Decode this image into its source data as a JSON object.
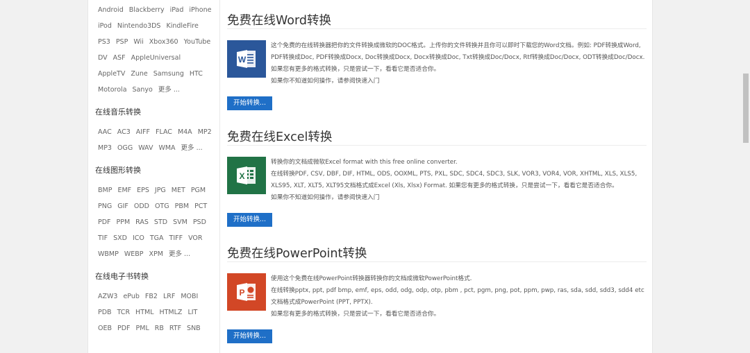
{
  "sidebar": {
    "devices": [
      "Android",
      "Blackberry",
      "iPad",
      "iPhone",
      "iPod",
      "Nintendo3DS",
      "KindleFire",
      "PS3",
      "PSP",
      "Wii",
      "Xbox360",
      "YouTube",
      "DV",
      "ASF",
      "AppleUniversal",
      "AppleTV",
      "Zune",
      "Samsung",
      "HTC",
      "Motorola",
      "Sanyo",
      "更多 ..."
    ],
    "music_title": "在线音乐转换",
    "music": [
      "AAC",
      "AC3",
      "AIFF",
      "FLAC",
      "M4A",
      "MP2",
      "MP3",
      "OGG",
      "WAV",
      "WMA",
      "更多 ..."
    ],
    "image_title": "在线图形转换",
    "image": [
      "BMP",
      "EMF",
      "EPS",
      "JPG",
      "MET",
      "PGM",
      "PNG",
      "GIF",
      "ODD",
      "OTG",
      "PBM",
      "PCT",
      "PDF",
      "PPM",
      "RAS",
      "STD",
      "SVM",
      "PSD",
      "TIF",
      "SXD",
      "ICO",
      "TGA",
      "TIFF",
      "VOR",
      "WBMP",
      "WEBP",
      "XPM",
      "更多 ..."
    ],
    "ebook_title": "在线电子书转换",
    "ebook": [
      "AZW3",
      "ePub",
      "FB2",
      "LRF",
      "MOBI",
      "PDB",
      "TCR",
      "HTML",
      "HTMLZ",
      "LIT",
      "OEB",
      "PDF",
      "PML",
      "RB",
      "RTF",
      "SNB"
    ]
  },
  "word": {
    "title": "免费在线Word转换",
    "line1": "这个免费的在线转换器把你的文件转换成微软的DOC格式。上传你的文件转换并且你可以即时下载您的Word文档。例如: PDF转换成Word, PDF转换成Doc, PDF转换成Docx, Doc转换成Docx, Docx转换成Doc, Txt转换成Doc/Docx, Rtf转换成Doc/Docx, ODT转换成Doc/Docx. 如果您有更多的格式转换，只是尝试一下，看看它是否适合你。",
    "line2": "如果你不知道如何操作，请参阅快速入门",
    "button": "开始转换..."
  },
  "excel": {
    "title": "免费在线Excel转换",
    "line1": "转换你的文档成微软Excel format with this free online converter.",
    "line2": "在线转换PDF, CSV, DBF, DIF, HTML, ODS, OOXML, PTS, PXL, SDC, SDC4, SDC3, SLK, VOR3, VOR4, VOR, XHTML, XLS, XLS5, XLS95, XLT, XLT5, XLT95文档格式成Excel (Xls, Xlsx) Format. 如果您有更多的格式转换，只是尝试一下，看看它是否适合你。",
    "line3": "如果你不知道如何操作，请参阅快速入门",
    "button": "开始转换..."
  },
  "ppt": {
    "title": "免费在线PowerPoint转换",
    "line1": "使用这个免费在线PowerPoint转换器转换你的文档成微软PowerPoint格式.",
    "line2": "在线转换pptx, ppt, pdf bmp, emf, eps, odd, odg, odp, otp, pbm , pct, pgm, png, pot, ppm, pwp, ras, sda, sdd, sdd3, sdd4 etc文档格式成PowerPoint (PPT, PPTX).",
    "line3": "如果您有更多的格式转换，只是尝试一下，看看它是否适合你。",
    "button": "开始转换..."
  },
  "colors": {
    "word": "#2b579a",
    "excel": "#217346",
    "ppt": "#d24726",
    "button": "#1f6fc7"
  }
}
